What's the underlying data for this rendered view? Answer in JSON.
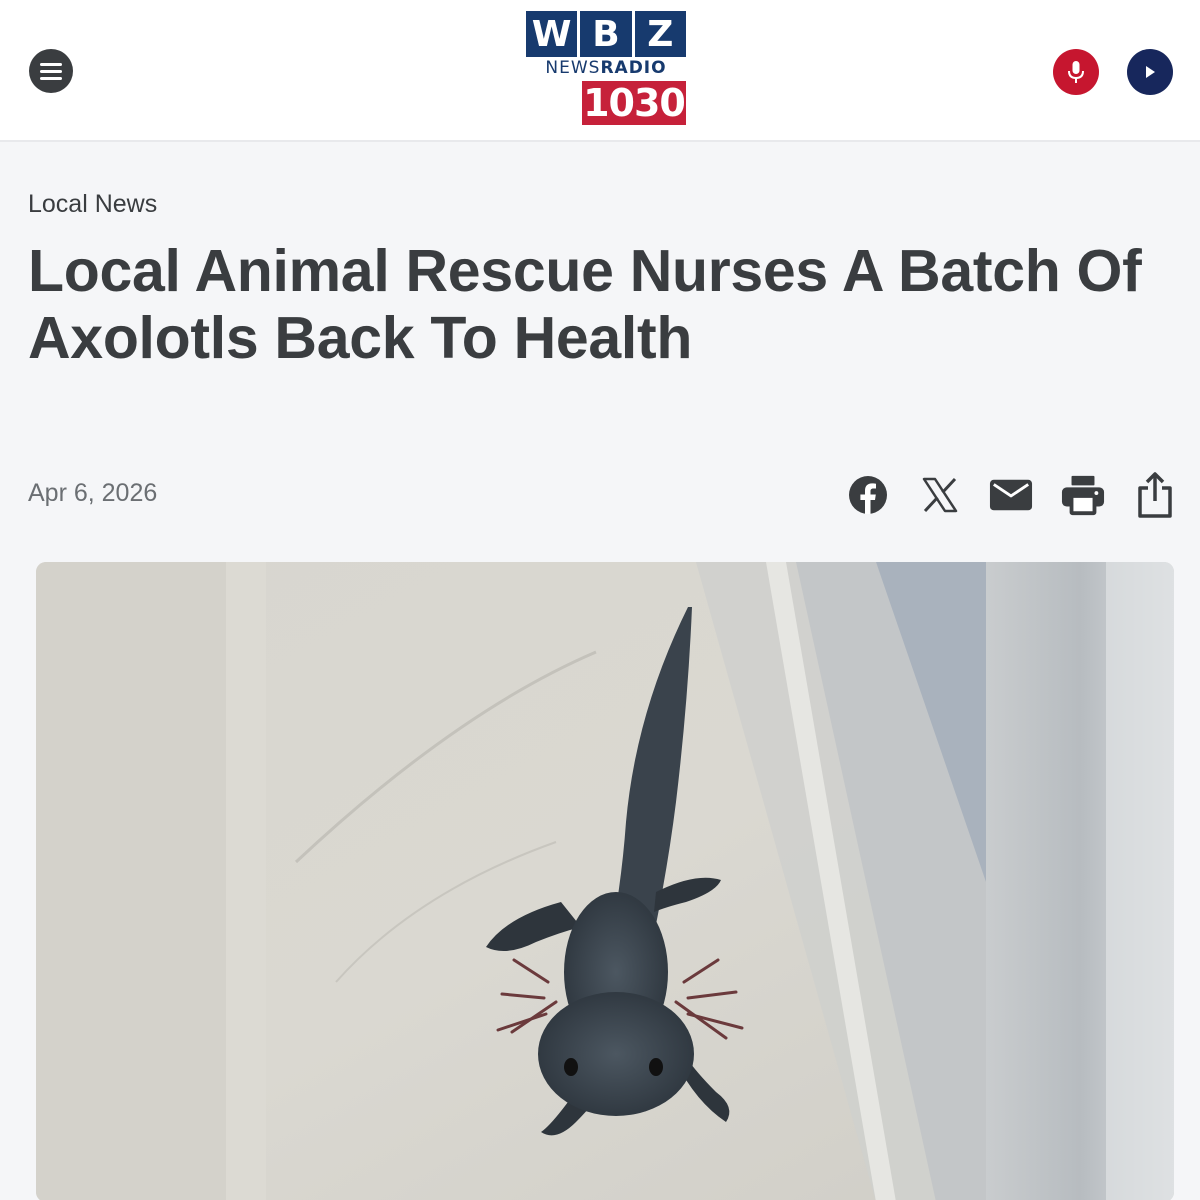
{
  "header": {
    "logo": {
      "letters": [
        "W",
        "B",
        "Z"
      ],
      "news": "NEWS",
      "radio": "RADIO",
      "frequency": "1030",
      "brand_blue": "#173a6e",
      "brand_red": "#c6213a"
    },
    "menu_icon": "hamburger-icon",
    "mic_icon": "microphone-icon",
    "play_icon": "play-icon"
  },
  "article": {
    "category": "Local News",
    "headline": "Local Animal Rescue Nurses A Batch Of Axolotls Back To Health",
    "date": "Apr 6, 2026"
  },
  "share": {
    "icons": [
      "facebook-icon",
      "x-icon",
      "email-icon",
      "print-icon",
      "share-icon"
    ]
  },
  "colors": {
    "text": "#3a3d40",
    "muted": "#6b6f73",
    "page_bg": "#f5f6f8"
  }
}
